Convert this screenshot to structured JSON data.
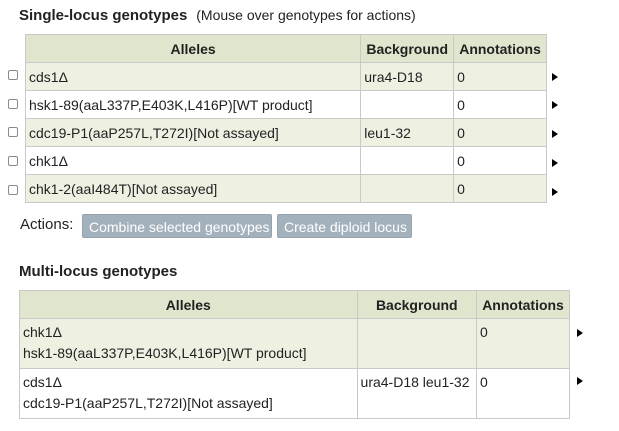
{
  "single": {
    "title": "Single-locus genotypes",
    "hint": "(Mouse over genotypes for actions)",
    "headers": {
      "alleles": "Alleles",
      "background": "Background",
      "annotations": "Annotations"
    },
    "rows": [
      {
        "alleles": "cds1Δ",
        "background": "ura4-D18",
        "annotations": "0"
      },
      {
        "alleles": "hsk1-89(aaL337P,E403K,L416P)[WT product]",
        "background": "",
        "annotations": "0"
      },
      {
        "alleles": "cdc19-P1(aaP257L,T272I)[Not assayed]",
        "background": "leu1-32",
        "annotations": "0"
      },
      {
        "alleles": "chk1Δ",
        "background": "",
        "annotations": "0"
      },
      {
        "alleles": "chk1-2(aaI484T)[Not assayed]",
        "background": "",
        "annotations": "0"
      }
    ]
  },
  "actions": {
    "label": "Actions:",
    "combine": "Combine selected genotypes",
    "diploid": "Create diploid locus"
  },
  "multi": {
    "title": "Multi-locus genotypes",
    "headers": {
      "alleles": "Alleles",
      "background": "Background",
      "annotations": "Annotations"
    },
    "rows": [
      {
        "allele1": "chk1Δ",
        "allele2": "hsk1-89(aaL337P,E403K,L416P)[WT product]",
        "background": "",
        "annotations": "0"
      },
      {
        "allele1": "cds1Δ",
        "allele2": "cdc19-P1(aaP257L,T272I)[Not assayed]",
        "background": "ura4-D18 leu1-32",
        "annotations": "0"
      }
    ]
  }
}
